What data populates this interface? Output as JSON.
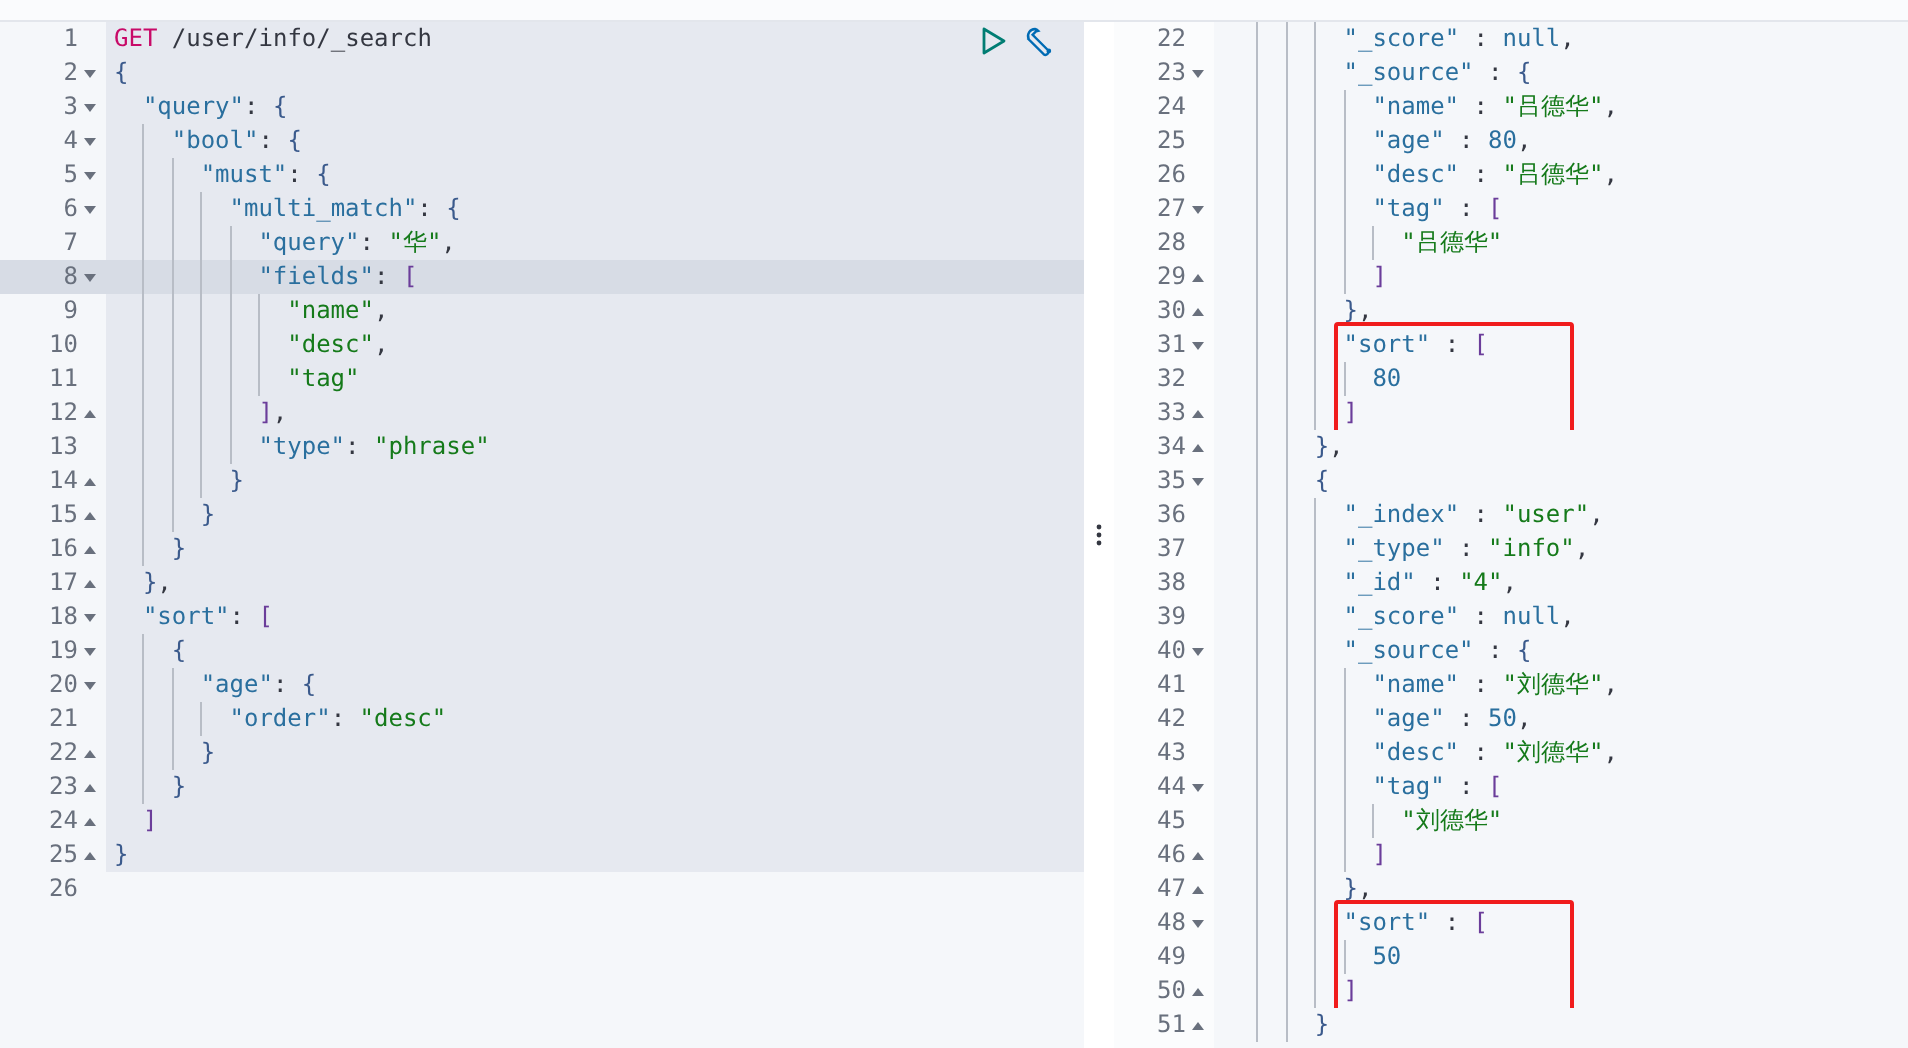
{
  "request_editor": {
    "lines": [
      {
        "n": "1",
        "selected": false,
        "active": true,
        "tokens": [
          {
            "kind": "method",
            "text": "GET"
          },
          {
            "kind": "path",
            "text": " /user/info/_search"
          }
        ]
      },
      {
        "n": "2",
        "selected": false,
        "active": true,
        "fold_start": true,
        "tokens": [
          {
            "kind": "brace",
            "text": "{"
          }
        ]
      },
      {
        "n": "3",
        "selected": false,
        "active": true,
        "fold_start": true,
        "tokens": [
          {
            "kind": "key",
            "text": "  \"query\""
          },
          {
            "kind": "punct",
            "text": ": "
          },
          {
            "kind": "brace",
            "text": "{"
          }
        ]
      },
      {
        "n": "4",
        "selected": false,
        "active": true,
        "fold_start": true,
        "tokens": [
          {
            "kind": "key",
            "text": "    \"bool\""
          },
          {
            "kind": "punct",
            "text": ": "
          },
          {
            "kind": "brace",
            "text": "{"
          }
        ]
      },
      {
        "n": "5",
        "selected": false,
        "active": true,
        "fold_start": true,
        "tokens": [
          {
            "kind": "key",
            "text": "      \"must\""
          },
          {
            "kind": "punct",
            "text": ": "
          },
          {
            "kind": "brace",
            "text": "{"
          }
        ]
      },
      {
        "n": "6",
        "selected": false,
        "active": true,
        "fold_start": true,
        "tokens": [
          {
            "kind": "key",
            "text": "        \"multi_match\""
          },
          {
            "kind": "punct",
            "text": ": "
          },
          {
            "kind": "brace",
            "text": "{"
          }
        ]
      },
      {
        "n": "7",
        "selected": false,
        "active": true,
        "tokens": [
          {
            "kind": "key",
            "text": "          \"query\""
          },
          {
            "kind": "punct",
            "text": ": "
          },
          {
            "kind": "string",
            "text": "\"华\""
          },
          {
            "kind": "punct",
            "text": ","
          }
        ]
      },
      {
        "n": "8",
        "selected": true,
        "active": true,
        "fold_start": true,
        "tokens": [
          {
            "kind": "key",
            "text": "          \"fields\""
          },
          {
            "kind": "punct",
            "text": ": "
          },
          {
            "kind": "bracket",
            "text": "["
          }
        ]
      },
      {
        "n": "9",
        "selected": false,
        "active": true,
        "tokens": [
          {
            "kind": "string",
            "text": "            \"name\""
          },
          {
            "kind": "punct",
            "text": ","
          }
        ]
      },
      {
        "n": "10",
        "selected": false,
        "active": true,
        "tokens": [
          {
            "kind": "string",
            "text": "            \"desc\""
          },
          {
            "kind": "punct",
            "text": ","
          }
        ]
      },
      {
        "n": "11",
        "selected": false,
        "active": true,
        "tokens": [
          {
            "kind": "string",
            "text": "            \"tag\""
          }
        ]
      },
      {
        "n": "12",
        "selected": false,
        "active": true,
        "fold_end": true,
        "tokens": [
          {
            "kind": "bracket",
            "text": "          ]"
          },
          {
            "kind": "punct",
            "text": ","
          }
        ]
      },
      {
        "n": "13",
        "selected": false,
        "active": true,
        "tokens": [
          {
            "kind": "key",
            "text": "          \"type\""
          },
          {
            "kind": "punct",
            "text": ": "
          },
          {
            "kind": "string",
            "text": "\"phrase\""
          }
        ]
      },
      {
        "n": "14",
        "selected": false,
        "active": true,
        "fold_end": true,
        "tokens": [
          {
            "kind": "brace",
            "text": "        }"
          }
        ]
      },
      {
        "n": "15",
        "selected": false,
        "active": true,
        "fold_end": true,
        "tokens": [
          {
            "kind": "brace",
            "text": "      }"
          }
        ]
      },
      {
        "n": "16",
        "selected": false,
        "active": true,
        "fold_end": true,
        "tokens": [
          {
            "kind": "brace",
            "text": "    }"
          }
        ]
      },
      {
        "n": "17",
        "selected": false,
        "active": true,
        "fold_end": true,
        "tokens": [
          {
            "kind": "brace",
            "text": "  }"
          },
          {
            "kind": "punct",
            "text": ","
          }
        ]
      },
      {
        "n": "18",
        "selected": false,
        "active": true,
        "fold_start": true,
        "tokens": [
          {
            "kind": "key",
            "text": "  \"sort\""
          },
          {
            "kind": "punct",
            "text": ": "
          },
          {
            "kind": "bracket",
            "text": "["
          }
        ]
      },
      {
        "n": "19",
        "selected": false,
        "active": true,
        "fold_start": true,
        "tokens": [
          {
            "kind": "brace",
            "text": "    {"
          }
        ]
      },
      {
        "n": "20",
        "selected": false,
        "active": true,
        "fold_start": true,
        "tokens": [
          {
            "kind": "key",
            "text": "      \"age\""
          },
          {
            "kind": "punct",
            "text": ": "
          },
          {
            "kind": "brace",
            "text": "{"
          }
        ]
      },
      {
        "n": "21",
        "selected": false,
        "active": true,
        "tokens": [
          {
            "kind": "key",
            "text": "        \"order\""
          },
          {
            "kind": "punct",
            "text": ": "
          },
          {
            "kind": "string",
            "text": "\"desc\""
          }
        ]
      },
      {
        "n": "22",
        "selected": false,
        "active": true,
        "fold_end": true,
        "tokens": [
          {
            "kind": "brace",
            "text": "      }"
          }
        ]
      },
      {
        "n": "23",
        "selected": false,
        "active": true,
        "fold_end": true,
        "tokens": [
          {
            "kind": "brace",
            "text": "    }"
          }
        ]
      },
      {
        "n": "24",
        "selected": false,
        "active": true,
        "fold_end": true,
        "tokens": [
          {
            "kind": "bracket",
            "text": "  ]"
          }
        ]
      },
      {
        "n": "25",
        "selected": false,
        "active": true,
        "fold_end": true,
        "tokens": [
          {
            "kind": "brace",
            "text": "}"
          }
        ]
      },
      {
        "n": "26",
        "selected": false,
        "active": false
      }
    ]
  },
  "response_viewer": {
    "lines": [
      {
        "n": "22",
        "tokens": [
          {
            "kind": "key",
            "text": "        \"_score\""
          },
          {
            "kind": "punct",
            "text": " : "
          },
          {
            "kind": "literal",
            "text": "null"
          },
          {
            "kind": "punct",
            "text": ","
          }
        ]
      },
      {
        "n": "23",
        "fold_start": true,
        "tokens": [
          {
            "kind": "key",
            "text": "        \"_source\""
          },
          {
            "kind": "punct",
            "text": " : "
          },
          {
            "kind": "brace",
            "text": "{"
          }
        ]
      },
      {
        "n": "24",
        "tokens": [
          {
            "kind": "key",
            "text": "          \"name\""
          },
          {
            "kind": "punct",
            "text": " : "
          },
          {
            "kind": "string",
            "text": "\"吕德华\""
          },
          {
            "kind": "punct",
            "text": ","
          }
        ]
      },
      {
        "n": "25",
        "tokens": [
          {
            "kind": "key",
            "text": "          \"age\""
          },
          {
            "kind": "punct",
            "text": " : "
          },
          {
            "kind": "literal",
            "text": "80"
          },
          {
            "kind": "punct",
            "text": ","
          }
        ]
      },
      {
        "n": "26",
        "tokens": [
          {
            "kind": "key",
            "text": "          \"desc\""
          },
          {
            "kind": "punct",
            "text": " : "
          },
          {
            "kind": "string",
            "text": "\"吕德华\""
          },
          {
            "kind": "punct",
            "text": ","
          }
        ]
      },
      {
        "n": "27",
        "fold_start": true,
        "tokens": [
          {
            "kind": "key",
            "text": "          \"tag\""
          },
          {
            "kind": "punct",
            "text": " : "
          },
          {
            "kind": "bracket",
            "text": "["
          }
        ]
      },
      {
        "n": "28",
        "tokens": [
          {
            "kind": "string",
            "text": "            \"吕德华\""
          }
        ]
      },
      {
        "n": "29",
        "fold_end": true,
        "tokens": [
          {
            "kind": "bracket",
            "text": "          ]"
          }
        ]
      },
      {
        "n": "30",
        "fold_end": true,
        "tokens": [
          {
            "kind": "brace",
            "text": "        }"
          },
          {
            "kind": "punct",
            "text": ","
          }
        ]
      },
      {
        "n": "31",
        "fold_start": true,
        "boxed": true,
        "tokens": [
          {
            "kind": "key",
            "text": "        \"sort\""
          },
          {
            "kind": "punct",
            "text": " : "
          },
          {
            "kind": "bracket",
            "text": "["
          }
        ]
      },
      {
        "n": "32",
        "boxed": true,
        "tokens": [
          {
            "kind": "literal",
            "text": "          80"
          }
        ]
      },
      {
        "n": "33",
        "fold_end": true,
        "boxed": true,
        "tokens": [
          {
            "kind": "bracket",
            "text": "        ]"
          }
        ]
      },
      {
        "n": "34",
        "fold_end": true,
        "tokens": [
          {
            "kind": "brace",
            "text": "      }"
          },
          {
            "kind": "punct",
            "text": ","
          }
        ]
      },
      {
        "n": "35",
        "fold_start": true,
        "tokens": [
          {
            "kind": "brace",
            "text": "      {"
          }
        ]
      },
      {
        "n": "36",
        "tokens": [
          {
            "kind": "key",
            "text": "        \"_index\""
          },
          {
            "kind": "punct",
            "text": " : "
          },
          {
            "kind": "string",
            "text": "\"user\""
          },
          {
            "kind": "punct",
            "text": ","
          }
        ]
      },
      {
        "n": "37",
        "tokens": [
          {
            "kind": "key",
            "text": "        \"_type\""
          },
          {
            "kind": "punct",
            "text": " : "
          },
          {
            "kind": "string",
            "text": "\"info\""
          },
          {
            "kind": "punct",
            "text": ","
          }
        ]
      },
      {
        "n": "38",
        "tokens": [
          {
            "kind": "key",
            "text": "        \"_id\""
          },
          {
            "kind": "punct",
            "text": " : "
          },
          {
            "kind": "string",
            "text": "\"4\""
          },
          {
            "kind": "punct",
            "text": ","
          }
        ]
      },
      {
        "n": "39",
        "tokens": [
          {
            "kind": "key",
            "text": "        \"_score\""
          },
          {
            "kind": "punct",
            "text": " : "
          },
          {
            "kind": "literal",
            "text": "null"
          },
          {
            "kind": "punct",
            "text": ","
          }
        ]
      },
      {
        "n": "40",
        "fold_start": true,
        "tokens": [
          {
            "kind": "key",
            "text": "        \"_source\""
          },
          {
            "kind": "punct",
            "text": " : "
          },
          {
            "kind": "brace",
            "text": "{"
          }
        ]
      },
      {
        "n": "41",
        "tokens": [
          {
            "kind": "key",
            "text": "          \"name\""
          },
          {
            "kind": "punct",
            "text": " : "
          },
          {
            "kind": "string",
            "text": "\"刘德华\""
          },
          {
            "kind": "punct",
            "text": ","
          }
        ]
      },
      {
        "n": "42",
        "tokens": [
          {
            "kind": "key",
            "text": "          \"age\""
          },
          {
            "kind": "punct",
            "text": " : "
          },
          {
            "kind": "literal",
            "text": "50"
          },
          {
            "kind": "punct",
            "text": ","
          }
        ]
      },
      {
        "n": "43",
        "tokens": [
          {
            "kind": "key",
            "text": "          \"desc\""
          },
          {
            "kind": "punct",
            "text": " : "
          },
          {
            "kind": "string",
            "text": "\"刘德华\""
          },
          {
            "kind": "punct",
            "text": ","
          }
        ]
      },
      {
        "n": "44",
        "fold_start": true,
        "tokens": [
          {
            "kind": "key",
            "text": "          \"tag\""
          },
          {
            "kind": "punct",
            "text": " : "
          },
          {
            "kind": "bracket",
            "text": "["
          }
        ]
      },
      {
        "n": "45",
        "tokens": [
          {
            "kind": "string",
            "text": "            \"刘德华\""
          }
        ]
      },
      {
        "n": "46",
        "fold_end": true,
        "tokens": [
          {
            "kind": "bracket",
            "text": "          ]"
          }
        ]
      },
      {
        "n": "47",
        "fold_end": true,
        "tokens": [
          {
            "kind": "brace",
            "text": "        }"
          },
          {
            "kind": "punct",
            "text": ","
          }
        ]
      },
      {
        "n": "48",
        "fold_start": true,
        "boxed": true,
        "tokens": [
          {
            "kind": "key",
            "text": "        \"sort\""
          },
          {
            "kind": "punct",
            "text": " : "
          },
          {
            "kind": "bracket",
            "text": "["
          }
        ]
      },
      {
        "n": "49",
        "boxed": true,
        "tokens": [
          {
            "kind": "literal",
            "text": "          50"
          }
        ]
      },
      {
        "n": "50",
        "fold_end": true,
        "boxed": true,
        "tokens": [
          {
            "kind": "bracket",
            "text": "        ]"
          }
        ]
      },
      {
        "n": "51",
        "fold_end": true,
        "tokens": [
          {
            "kind": "brace",
            "text": "      }"
          }
        ]
      }
    ]
  }
}
